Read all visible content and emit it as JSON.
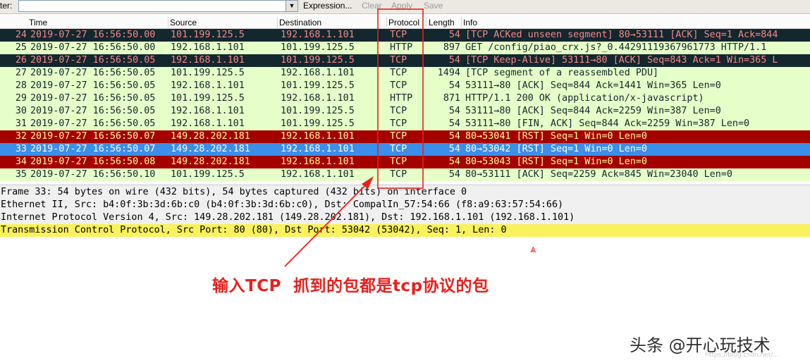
{
  "toolbar": {
    "filter_label": "ter:",
    "filter_value": "",
    "expression_label": "Expression...",
    "clear_label": "Clear",
    "apply_label": "Apply",
    "save_label": "Save"
  },
  "columns": {
    "no": "",
    "time": "Time",
    "source": "Source",
    "destination": "Destination",
    "protocol": "Protocol",
    "length": "Length",
    "info": "Info"
  },
  "packets": [
    {
      "no": "24",
      "time": "2019-07-27  16:56:50.00",
      "src": "101.199.125.5",
      "dst": "192.168.1.101",
      "proto": "TCP",
      "len": "54",
      "info": "[TCP ACKed unseen segment] 80→53111 [ACK] Seq=1 Ack=844",
      "style": "dark"
    },
    {
      "no": "25",
      "time": "2019-07-27  16:56:50.00",
      "src": "192.168.1.101",
      "dst": "101.199.125.5",
      "proto": "HTTP",
      "len": "897",
      "info": "GET /config/piao_crx.js?_0.44291119367961773 HTTP/1.1",
      "style": "green"
    },
    {
      "no": "26",
      "time": "2019-07-27  16:56:50.05",
      "src": "192.168.1.101",
      "dst": "101.199.125.5",
      "proto": "TCP",
      "len": "54",
      "info": "[TCP Keep-Alive] 53111→80 [ACK] Seq=843 Ack=1 Win=365 L",
      "style": "dark"
    },
    {
      "no": "27",
      "time": "2019-07-27  16:56:50.05",
      "src": "101.199.125.5",
      "dst": "192.168.1.101",
      "proto": "TCP",
      "len": "1494",
      "info": "[TCP segment of a reassembled PDU]",
      "style": "green"
    },
    {
      "no": "28",
      "time": "2019-07-27  16:56:50.05",
      "src": "192.168.1.101",
      "dst": "101.199.125.5",
      "proto": "TCP",
      "len": "54",
      "info": "53111→80 [ACK] Seq=844 Ack=1441 Win=365 Len=0",
      "style": "green"
    },
    {
      "no": "29",
      "time": "2019-07-27  16:56:50.05",
      "src": "101.199.125.5",
      "dst": "192.168.1.101",
      "proto": "HTTP",
      "len": "871",
      "info": "HTTP/1.1 200 OK  (application/x-javascript)",
      "style": "green"
    },
    {
      "no": "30",
      "time": "2019-07-27  16:56:50.05",
      "src": "192.168.1.101",
      "dst": "101.199.125.5",
      "proto": "TCP",
      "len": "54",
      "info": "53111→80 [ACK] Seq=844 Ack=2259 Win=387 Len=0",
      "style": "green"
    },
    {
      "no": "31",
      "time": "2019-07-27  16:56:50.05",
      "src": "192.168.1.101",
      "dst": "101.199.125.5",
      "proto": "TCP",
      "len": "54",
      "info": "53111→80 [FIN, ACK] Seq=844 Ack=2259 Win=387 Len=0",
      "style": "green"
    },
    {
      "no": "32",
      "time": "2019-07-27  16:56:50.07",
      "src": "149.28.202.181",
      "dst": "192.168.1.101",
      "proto": "TCP",
      "len": "54",
      "info": "80→53041 [RST] Seq=1 Win=0 Len=0",
      "style": "red"
    },
    {
      "no": "33",
      "time": "2019-07-27  16:56:50.07",
      "src": "149.28.202.181",
      "dst": "192.168.1.101",
      "proto": "TCP",
      "len": "54",
      "info": "80→53042 [RST] Seq=1 Win=0 Len=0",
      "style": "selected"
    },
    {
      "no": "34",
      "time": "2019-07-27  16:56:50.08",
      "src": "149.28.202.181",
      "dst": "192.168.1.101",
      "proto": "TCP",
      "len": "54",
      "info": "80→53043 [RST] Seq=1 Win=0 Len=0",
      "style": "red"
    },
    {
      "no": "35",
      "time": "2019-07-27  16:56:50.10",
      "src": "101.199.125.5",
      "dst": "192.168.1.101",
      "proto": "TCP",
      "len": "54",
      "info": "80→53111 [ACK] Seq=2259 Ack=845 Win=23040 Len=0",
      "style": "green"
    }
  ],
  "details": [
    {
      "text": "Frame 33: 54 bytes on wire (432 bits), 54 bytes captured (432 bits) on interface 0",
      "highlighted": false
    },
    {
      "text": "Ethernet II, Src: b4:0f:3b:3d:6b:c0 (b4:0f:3b:3d:6b:c0), Dst: CompalIn_57:54:66 (f8:a9:63:57:54:66)",
      "highlighted": false
    },
    {
      "text": "Internet Protocol Version 4, Src: 149.28.202.181 (149.28.202.181), Dst: 192.168.1.101 (192.168.1.101)",
      "highlighted": false
    },
    {
      "text": "Transmission Control Protocol, Src Port: 80 (80), Dst Port: 53042 (53042), Seq: 1, Len: 0",
      "highlighted": true
    }
  ],
  "annotation": {
    "text": "输入TCP  抓到的包都是tcp协议的包",
    "color": "#e8201d",
    "cursor_glyph": "⩓"
  },
  "watermark": {
    "text": "头条 @开心玩技术",
    "faint_url": "https://blog.csdn.net/..."
  },
  "colors": {
    "dark_row_bg": "#12272e",
    "dark_row_fg": "#f78788",
    "green_row_bg": "#e6ffc8",
    "red_row_bg": "#a40000",
    "red_row_fg": "#fffc9c",
    "selected_row_bg": "#3b8ee9",
    "detail_highlight_bg": "#f9f15d",
    "annotation_red": "#e8201d"
  }
}
